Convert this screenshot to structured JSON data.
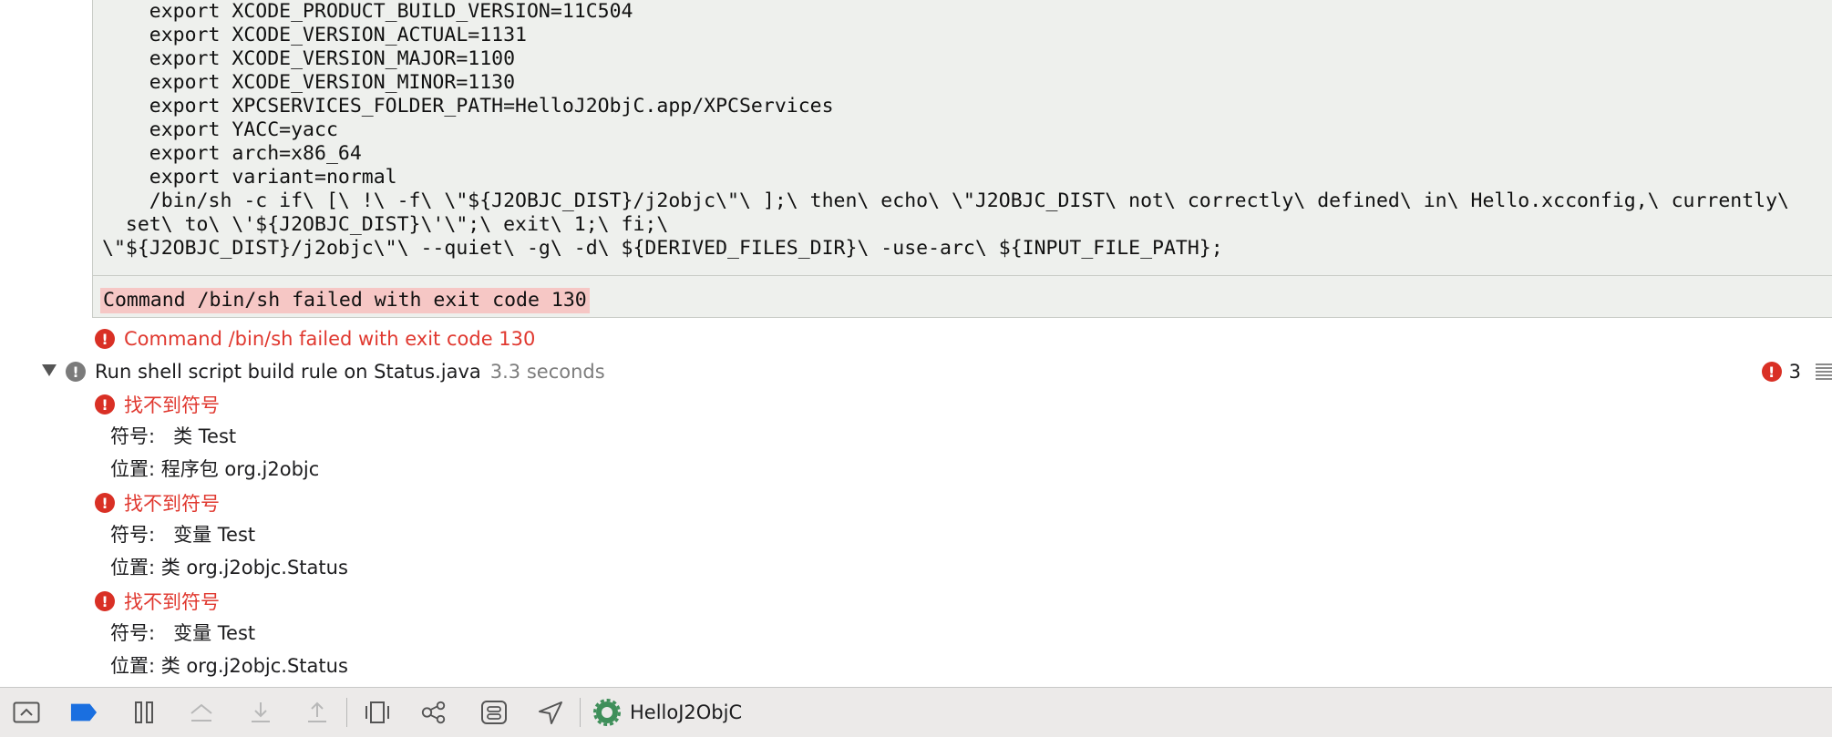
{
  "log": {
    "lines": [
      "    export XCODE_PRODUCT_BUILD_VERSION=11C504",
      "    export XCODE_VERSION_ACTUAL=1131",
      "    export XCODE_VERSION_MAJOR=1100",
      "    export XCODE_VERSION_MINOR=1130",
      "    export XPCSERVICES_FOLDER_PATH=HelloJ2ObjC.app/XPCServices",
      "    export YACC=yacc",
      "    export arch=x86_64",
      "    export variant=normal",
      "    /bin/sh -c if\\ [\\ !\\ -f\\ \\\"${J2OBJC_DIST}/j2objc\\\"\\ ];\\ then\\ echo\\ \\\"J2OBJC_DIST\\ not\\ correctly\\ defined\\ in\\ Hello.xcconfig,\\ currently\\",
      "  set\\ to\\ \\'${J2OBJC_DIST}\\'\\\";\\ exit\\ 1;\\ fi;\\",
      "\\\"${J2OBJC_DIST}/j2objc\\\"\\ --quiet\\ -g\\ -d\\ ${DERIVED_FILES_DIR}\\ -use-arc\\ ${INPUT_FILE_PATH};"
    ],
    "command_failed": "Command /bin/sh failed with exit code 130"
  },
  "issues": {
    "command_error": "Command /bin/sh failed with exit code 130",
    "build_step": {
      "title": "Run shell script build rule on Status.java",
      "duration": "3.3 seconds",
      "error_count": "3"
    },
    "errors": [
      {
        "title": "找不到符号",
        "symbol": "符号:   类 Test",
        "location": "位置: 程序包 org.j2objc"
      },
      {
        "title": "找不到符号",
        "symbol": "符号:   变量 Test",
        "location": "位置: 类 org.j2objc.Status"
      },
      {
        "title": "找不到符号",
        "symbol": "符号:   变量 Test",
        "location": "位置: 类 org.j2objc.Status"
      }
    ],
    "error_glyph": "!"
  },
  "toolbar": {
    "target_name": "HelloJ2ObjC"
  },
  "colors": {
    "error_red": "#e0382f",
    "highlight": "#f6c7c5",
    "log_background": "#eef0ed",
    "breakpoint_blue": "#1a6fe0"
  }
}
